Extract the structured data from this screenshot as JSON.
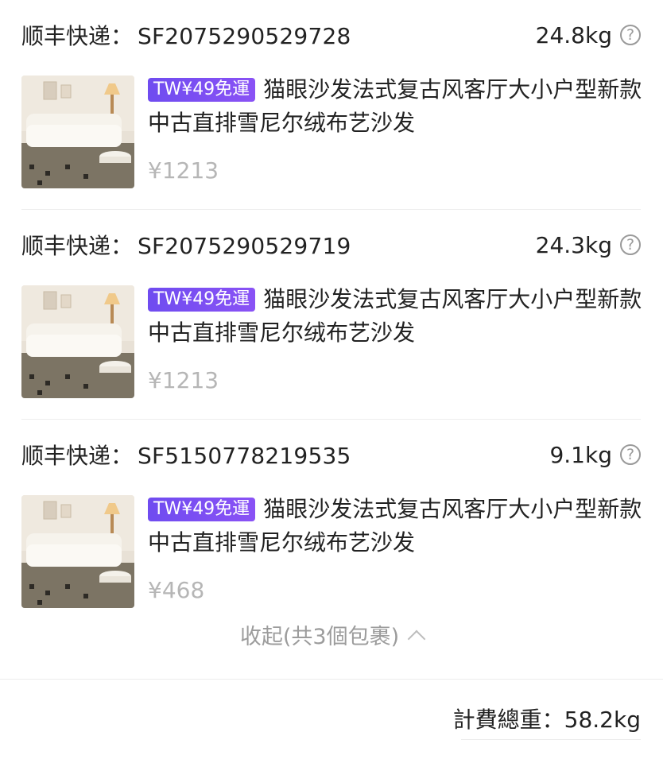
{
  "packages": [
    {
      "carrier_label": "顺丰快递：",
      "tracking_number": "SF2075290529728",
      "weight": "24.8kg",
      "tag": "TW¥49免運",
      "product_title": "猫眼沙发法式复古风客厅大小户型新款中古直排雪尼尔绒布艺沙发",
      "price": "¥1213"
    },
    {
      "carrier_label": "顺丰快递：",
      "tracking_number": "SF2075290529719",
      "weight": "24.3kg",
      "tag": "TW¥49免運",
      "product_title": "猫眼沙发法式复古风客厅大小户型新款中古直排雪尼尔绒布艺沙发",
      "price": "¥1213"
    },
    {
      "carrier_label": "顺丰快递：",
      "tracking_number": "SF5150778219535",
      "weight": "9.1kg",
      "tag": "TW¥49免運",
      "product_title": "猫眼沙发法式复古风客厅大小户型新款中古直排雪尼尔绒布艺沙发",
      "price": "¥468"
    }
  ],
  "help_icon_glyph": "?",
  "collapse_label": "收起(共3個包裹)",
  "total_label": "計費總重：",
  "total_weight": "58.2kg",
  "colors": {
    "tag_bg": "#7650f2",
    "price_gray": "#b6b6b6"
  }
}
